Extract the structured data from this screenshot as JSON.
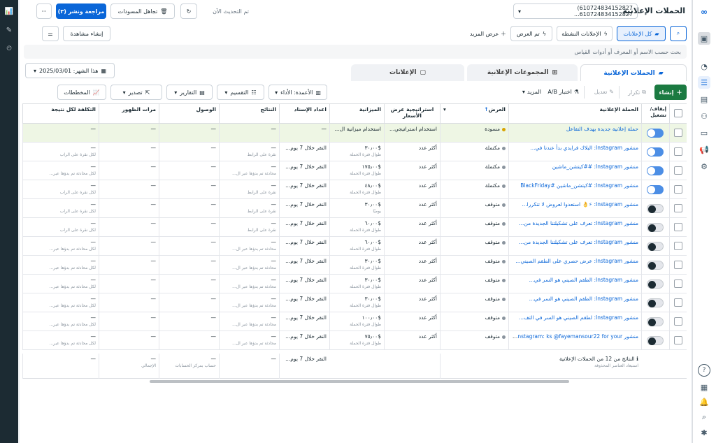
{
  "header": {
    "title": "الحملات الإعلانية",
    "account": "610724834152827) 610724834152827...",
    "updated": "تم التحديث الآن",
    "discard_drafts": "تجاهل المسودات",
    "review_publish": "مراجعة ونشر (٣)",
    "more": "···"
  },
  "filters": {
    "all_ads": "كل الإعلانات",
    "active_ads": "الإعلانات النشطة",
    "viewed": "تم العرض",
    "show_more": "عرض المزيد",
    "create_view": "إنشاء مشاهدة"
  },
  "search": {
    "placeholder": "بحث حسب الاسم أو المعرف أو أدوات القياس"
  },
  "tabs": {
    "campaigns": "الحملات الإعلانية",
    "adsets": "المجموعات الإعلانية",
    "ads": "الإعلانات"
  },
  "date_range": "هذا الشهر: 2025/03/01",
  "toolbar": {
    "create": "إنشاء",
    "duplicate": "تكرار",
    "edit": "تعديل",
    "ab_test": "اختبار A/B",
    "more": "المزيد",
    "columns": "الأعمدة: الأداء",
    "breakdown": "التقسيم",
    "reports": "التقارير",
    "export": "تصدير",
    "charts": "المخططات"
  },
  "columns": {
    "onoff": "إيقاف/ تشغيل",
    "campaign": "الحملة الإعلانية",
    "delivery": "العرض",
    "bid": "استراتيجية عرض الأسعار",
    "budget": "الميزانية",
    "attribution": "اعداد الإسناد",
    "results": "النتائج",
    "reach": "الوصول",
    "impressions": "مرات الظهور",
    "cost": "التكلفة لكل نتيجة"
  },
  "rows": [
    {
      "on": true,
      "name": "حملة إعلانية جديدة بهدف التفاعل",
      "status": "مسودة",
      "dot": "#d8a300",
      "bid": "استخدام استراتيجي...",
      "budget": "استخدام ميزانية ال...",
      "budget_sub": "",
      "attr": "—",
      "results": "—",
      "results_sub": "",
      "reach": "—",
      "impr": "—",
      "cost": "—",
      "cost_sub": "",
      "draft": true
    },
    {
      "on": true,
      "name": "منشور Instagram: البلاك فرايدي بدأ عندنا في...",
      "status": "مكتملة",
      "dot": "#8a949e",
      "bid": "أكثر عدد",
      "budget": "$٣٠٫٠٠",
      "budget_sub": "طوال فترة الحملة",
      "attr": "النقر خلال 7 يوم...",
      "results": "—",
      "results_sub": "نقرة على الرابط",
      "reach": "—",
      "impr": "—",
      "cost": "—",
      "cost_sub": "لكل نقرة على الراب"
    },
    {
      "on": true,
      "name": "منشور Instagram: ##كيتشن_ماشين",
      "status": "مكتملة",
      "dot": "#8a949e",
      "bid": "أكثر عدد",
      "budget": "$١٧٥٫٠٠",
      "budget_sub": "طوال فترة الحملة",
      "attr": "النقر خلال 7 يوم...",
      "results": "—",
      "results_sub": "محادثة تم بدؤها عبر ال...",
      "reach": "—",
      "impr": "—",
      "cost": "—",
      "cost_sub": "لكل محادثة تم بدؤها عبر..."
    },
    {
      "on": true,
      "name": "منشور Instagram: #كيتشن_ماشين #BlackFriday",
      "status": "مكتملة",
      "dot": "#8a949e",
      "bid": "أكثر عدد",
      "budget": "$٤٨٫٠٠",
      "budget_sub": "طوال فترة الحملة",
      "attr": "النقر خلال 7 يوم...",
      "results": "—",
      "results_sub": "نقرة على الرابط",
      "reach": "—",
      "impr": "—",
      "cost": "—",
      "cost_sub": "لكل نقرة على الراب"
    },
    {
      "on": false,
      "name": "منشور Instagram: ⚡👌 استعدوا لعروض لا تتكررا...",
      "status": "متوقف",
      "dot": "#8a949e",
      "bid": "أكثر عدد",
      "budget": "$٣٠٫٠٠",
      "budget_sub": "يوميًا",
      "attr": "النقر خلال 7 يوم...",
      "results": "—",
      "results_sub": "نقرة على الرابط",
      "reach": "—",
      "impr": "—",
      "cost": "—",
      "cost_sub": "لكل نقرة على الراب"
    },
    {
      "on": false,
      "name": "منشور Instagram: تعرف على تشكيلتنا الجديدة من...",
      "status": "متوقف",
      "dot": "#8a949e",
      "bid": "أكثر عدد",
      "budget": "$٦٠٫٠٠",
      "budget_sub": "طوال فترة الحملة",
      "attr": "النقر خلال 7 يوم...",
      "results": "—",
      "results_sub": "نقرة على الرابط",
      "reach": "—",
      "impr": "—",
      "cost": "—",
      "cost_sub": "لكل نقرة على الراب"
    },
    {
      "on": false,
      "name": "منشور Instagram: تعرف على تشكيلتنا الجديدة من...",
      "status": "متوقف",
      "dot": "#8a949e",
      "bid": "أكثر عدد",
      "budget": "$٦٠٫٠٠",
      "budget_sub": "طوال فترة الحملة",
      "attr": "النقر خلال 7 يوم...",
      "results": "—",
      "results_sub": "محادثة تم بدؤها عبر ال...",
      "reach": "—",
      "impr": "—",
      "cost": "—",
      "cost_sub": "لكل محادثة تم بدؤها عبر..."
    },
    {
      "on": false,
      "name": "منشور Instagram: عرض حصري على الطقم الصيني...",
      "status": "متوقف",
      "dot": "#8a949e",
      "bid": "أكثر عدد",
      "budget": "$٣٠٫٠٠",
      "budget_sub": "طوال فترة الحملة",
      "attr": "النقر خلال 7 يوم...",
      "results": "—",
      "results_sub": "محادثة تم بدؤها عبر ال...",
      "reach": "—",
      "impr": "—",
      "cost": "—",
      "cost_sub": "لكل محادثة تم بدؤها عبر..."
    },
    {
      "on": false,
      "name": "منشور Instagram: الطقم الصيني هو السر في...",
      "status": "متوقف",
      "dot": "#8a949e",
      "bid": "أكثر عدد",
      "budget": "$٣٠٫٠٠",
      "budget_sub": "طوال فترة الحملة",
      "attr": "النقر خلال 7 يوم...",
      "results": "—",
      "results_sub": "محادثة تم بدؤها عبر ال...",
      "reach": "—",
      "impr": "—",
      "cost": "—",
      "cost_sub": "لكل محادثة تم بدؤها عبر..."
    },
    {
      "on": false,
      "name": "منشور Instagram: الطقم الصيني هو السر في...",
      "status": "متوقف",
      "dot": "#8a949e",
      "bid": "أكثر عدد",
      "budget": "$٣٠٫٠٠",
      "budget_sub": "طوال فترة الحملة",
      "attr": "النقر خلال 7 يوم...",
      "results": "—",
      "results_sub": "محادثة تم بدؤها عبر ال...",
      "reach": "—",
      "impr": "—",
      "cost": "—",
      "cost_sub": "لكل محادثة تم بدؤها عبر..."
    },
    {
      "on": false,
      "name": "منشور Instagram: لطقم الصيني هو السر في التف...",
      "status": "متوقف",
      "dot": "#8a949e",
      "bid": "أكثر عدد",
      "budget": "$١٠٠٫٠٠",
      "budget_sub": "طوال فترة الحملة",
      "attr": "النقر خلال 7 يوم...",
      "results": "—",
      "results_sub": "محادثة تم بدؤها عبر ال...",
      "reach": "—",
      "impr": "—",
      "cost": "—",
      "cost_sub": "لكل محادثة تم بدؤها عبر..."
    },
    {
      "on": false,
      "name": "منشور Instagram: ks @fayemansour22 for your...",
      "status": "متوقف",
      "dot": "#8a949e",
      "bid": "أكثر عدد",
      "budget": "$٧٥٫٠٠",
      "budget_sub": "طوال فترة الحملة",
      "attr": "النقر خلال 7 يوم...",
      "results": "—",
      "results_sub": "محادثة تم بدؤها عبر ال...",
      "reach": "—",
      "impr": "—",
      "cost": "—",
      "cost_sub": "لكل محادثة تم بدؤها عبر..."
    }
  ],
  "footer": {
    "summary": "النتائج من 12 من الحملات الإعلانية",
    "excluded": "استبعاد العناصر المحذوفة",
    "attr": "النقر خلال 7 يوم...",
    "results": "—",
    "reach": "—",
    "reach_sub": "حساب بمركز الحسابات",
    "impr": "—",
    "impr_sub": "الإجمالي",
    "cost": "—"
  }
}
